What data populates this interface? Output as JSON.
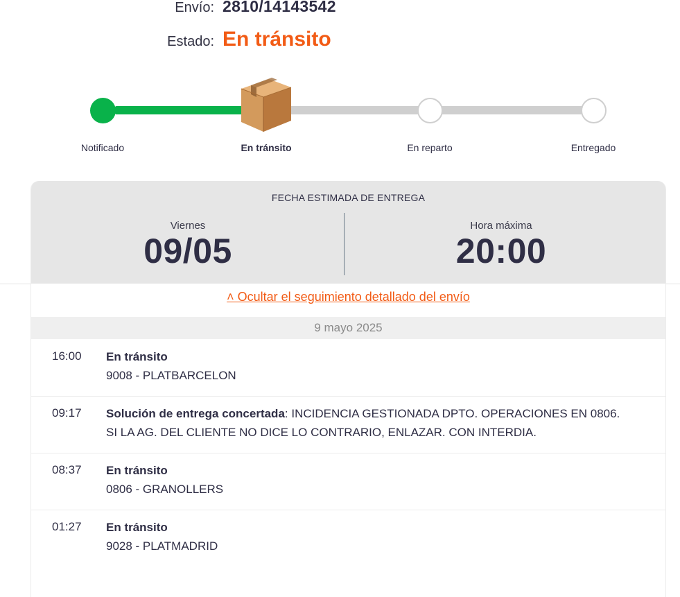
{
  "header": {
    "shipment_label": "Envío:",
    "shipment_number": "2810/14143542",
    "status_label": "Estado:",
    "status_value": "En tránsito"
  },
  "progress": {
    "current_step": 2,
    "steps": [
      {
        "label": "Notificado",
        "state": "done"
      },
      {
        "label": "En tránsito",
        "state": "current"
      },
      {
        "label": "En reparto",
        "state": "pending"
      },
      {
        "label": "Entregado",
        "state": "pending"
      }
    ],
    "colors": {
      "done": "#09b24a",
      "pending": "#cfcfcf",
      "accent": "#f25b15"
    },
    "current_icon": "package-box-icon"
  },
  "estimate": {
    "title": "FECHA ESTIMADA DE ENTREGA",
    "day_label": "Viernes",
    "date": "09/05",
    "time_label": "Hora máxima",
    "time": "20:00"
  },
  "tracking": {
    "toggle_label": "˄ Ocultar el seguimiento detallado del envío",
    "date_header": "9 mayo 2025",
    "events": [
      {
        "time": "16:00",
        "title": "En tránsito",
        "detail": "9008 - PLATBARCELON"
      },
      {
        "time": "09:17",
        "title": "Solución de entrega concertada",
        "detail": ": INCIDENCIA GESTIONADA DPTO. OPERACIONES EN 0806. SI LA AG. DEL CLIENTE NO DICE LO CONTRARIO, ENLAZAR. CON INTERDIA."
      },
      {
        "time": "08:37",
        "title": "En tránsito",
        "detail": "0806 - GRANOLLERS"
      },
      {
        "time": "01:27",
        "title": "En tránsito",
        "detail": "9028 - PLATMADRID"
      }
    ]
  }
}
